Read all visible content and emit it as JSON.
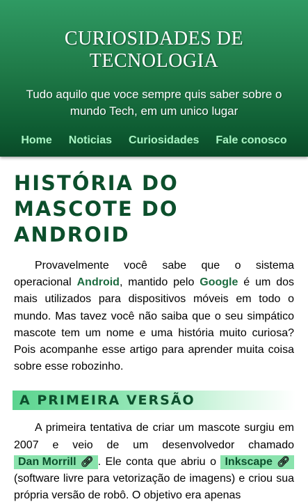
{
  "site": {
    "title_line1": "CURIOSIDADES DE",
    "title_line2": "TECNOLOGIA",
    "subtitle": "Tudo aquilo que voce sempre quis saber sobre o mundo Tech, em um unico lugar"
  },
  "nav": {
    "items": [
      {
        "label": "Home"
      },
      {
        "label": "Noticias"
      },
      {
        "label": "Curiosidades"
      },
      {
        "label": "Fale conosco"
      }
    ]
  },
  "article": {
    "title": "História do mascote do Android",
    "intro": {
      "t1": "Provavelmente você sabe que o sistema operacional ",
      "kw1": "Android",
      "t2": ", mantido pelo ",
      "kw2": "Google",
      "t3": " é um dos mais utilizados para dispositivos móveis em todo o mundo. Mas tavez você não saiba que o seu simpático mascote tem um nome e uma história muito curiosa? Pois acompanhe esse artigo para aprender muita coisa sobre esse robozinho."
    },
    "section1": {
      "heading": "A primeira versão",
      "t1": "A primeira tentativa de criar um mascote surgiu em 2007 e veio de um desenvolvedor chamado ",
      "link1": "Dan Morrill",
      "t2": ". Ele conta que abriu o ",
      "link2": "Inkscape",
      "t3": " (software livre para vetorização de imagens) e criou sua própria versão de robô. O objetivo era apenas"
    }
  },
  "icons": {
    "link": "chain-link-icon"
  },
  "colors": {
    "header_green": "#1f7a48",
    "nav_link": "#a9f5c4",
    "title_green": "#0c4f2c",
    "keyword_green": "#1c6b40",
    "chip_green": "#8ae3ad"
  }
}
